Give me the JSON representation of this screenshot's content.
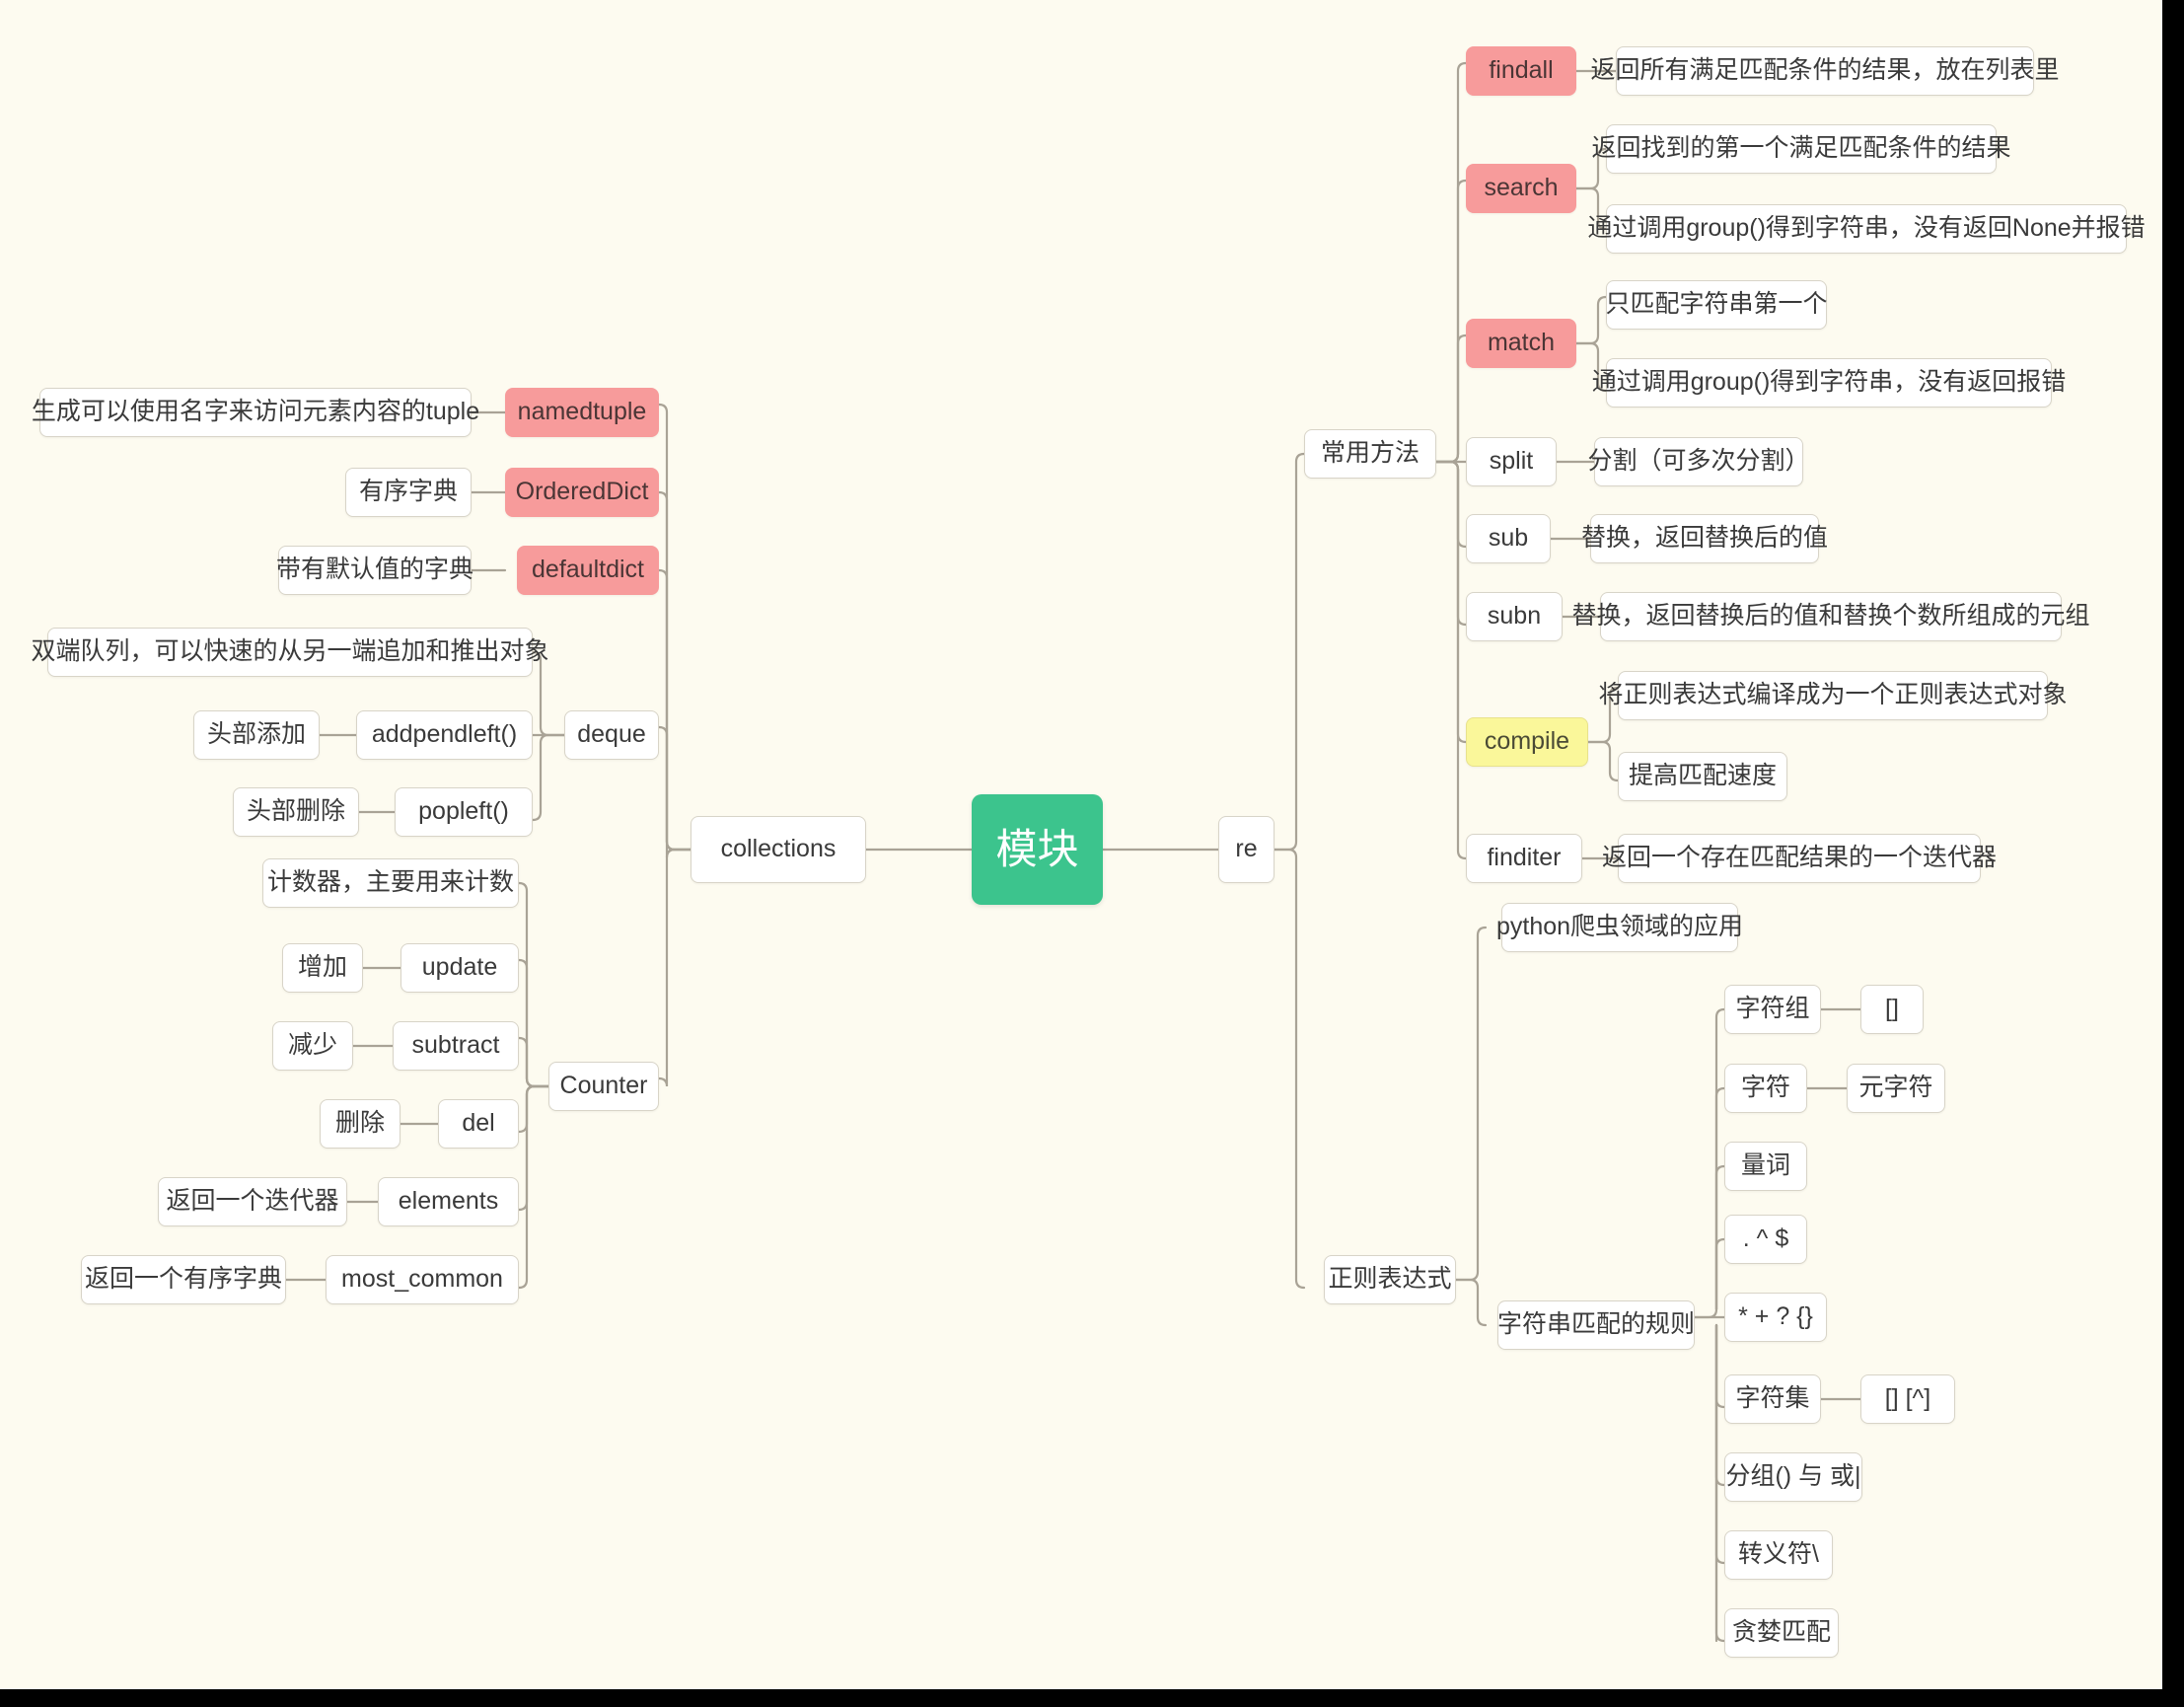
{
  "canvas": {
    "background": "#fdfbf0",
    "frame_color": "#000000",
    "edge_color": "#a9a396"
  },
  "root": {
    "label": "模块",
    "color": "#3cc48d",
    "text_color": "#ffffff"
  },
  "highlight_colors": {
    "pink": "#f79b9b",
    "yellow": "#faf79a",
    "plain": "#ffffff"
  },
  "branches": [
    {
      "id": "collections",
      "label": "collections",
      "side": "left",
      "children": [
        {
          "label": "namedtuple",
          "style": "pink",
          "children": [
            {
              "label": "生成可以使用名字来访问元素内容的tuple",
              "style": "plain"
            }
          ]
        },
        {
          "label": "OrderedDict",
          "style": "pink",
          "children": [
            {
              "label": "有序字典",
              "style": "plain"
            }
          ]
        },
        {
          "label": "defaultdict",
          "style": "pink",
          "children": [
            {
              "label": "带有默认值的字典",
              "style": "plain"
            }
          ]
        },
        {
          "label": "deque",
          "style": "plain",
          "children": [
            {
              "label": "双端队列，可以快速的从另一端追加和推出对象",
              "style": "plain"
            },
            {
              "label": "addpendleft()",
              "style": "plain",
              "children": [
                {
                  "label": "头部添加",
                  "style": "plain"
                }
              ]
            },
            {
              "label": "popleft()",
              "style": "plain",
              "children": [
                {
                  "label": "头部删除",
                  "style": "plain"
                }
              ]
            }
          ]
        },
        {
          "label": "Counter",
          "style": "plain",
          "children": [
            {
              "label": "计数器，主要用来计数",
              "style": "plain"
            },
            {
              "label": "update",
              "style": "plain",
              "children": [
                {
                  "label": "增加",
                  "style": "plain"
                }
              ]
            },
            {
              "label": "subtract",
              "style": "plain",
              "children": [
                {
                  "label": "减少",
                  "style": "plain"
                }
              ]
            },
            {
              "label": "del",
              "style": "plain",
              "children": [
                {
                  "label": "删除",
                  "style": "plain"
                }
              ]
            },
            {
              "label": "elements",
              "style": "plain",
              "children": [
                {
                  "label": "返回一个迭代器",
                  "style": "plain"
                }
              ]
            },
            {
              "label": "most_common",
              "style": "plain",
              "children": [
                {
                  "label": "返回一个有序字典",
                  "style": "plain"
                }
              ]
            }
          ]
        }
      ]
    },
    {
      "id": "re",
      "label": "re",
      "side": "right",
      "children": [
        {
          "label": "常用方法",
          "style": "plain",
          "children": [
            {
              "label": "findall",
              "style": "pink",
              "children": [
                {
                  "label": "返回所有满足匹配条件的结果，放在列表里",
                  "style": "plain"
                }
              ]
            },
            {
              "label": "search",
              "style": "pink",
              "children": [
                {
                  "label": "返回找到的第一个满足匹配条件的结果",
                  "style": "plain"
                },
                {
                  "label": "通过调用group()得到字符串，没有返回None并报错",
                  "style": "plain"
                }
              ]
            },
            {
              "label": "match",
              "style": "pink",
              "children": [
                {
                  "label": "只匹配字符串第一个",
                  "style": "plain"
                },
                {
                  "label": "通过调用group()得到字符串，没有返回报错",
                  "style": "plain"
                }
              ]
            },
            {
              "label": "split",
              "style": "plain",
              "children": [
                {
                  "label": "分割（可多次分割）",
                  "style": "plain"
                }
              ]
            },
            {
              "label": "sub",
              "style": "plain",
              "children": [
                {
                  "label": "替换，返回替换后的值",
                  "style": "plain"
                }
              ]
            },
            {
              "label": "subn",
              "style": "plain",
              "children": [
                {
                  "label": "替换，返回替换后的值和替换个数所组成的元组",
                  "style": "plain"
                }
              ]
            },
            {
              "label": "compile",
              "style": "yellow",
              "children": [
                {
                  "label": "将正则表达式编译成为一个正则表达式对象",
                  "style": "plain"
                },
                {
                  "label": "提高匹配速度",
                  "style": "plain"
                }
              ]
            },
            {
              "label": "finditer",
              "style": "plain",
              "children": [
                {
                  "label": "返回一个存在匹配结果的一个迭代器",
                  "style": "plain"
                }
              ]
            }
          ]
        },
        {
          "label": "正则表达式",
          "style": "plain",
          "children": [
            {
              "label": "python爬虫领域的应用",
              "style": "plain"
            },
            {
              "label": "字符串匹配的规则",
              "style": "plain",
              "children": [
                {
                  "label": "字符组",
                  "style": "plain",
                  "children": [
                    {
                      "label": "[]",
                      "style": "plain"
                    }
                  ]
                },
                {
                  "label": "字符",
                  "style": "plain",
                  "children": [
                    {
                      "label": "元字符",
                      "style": "plain"
                    }
                  ]
                },
                {
                  "label": "量词",
                  "style": "plain"
                },
                {
                  "label": ". ^ $",
                  "style": "plain"
                },
                {
                  "label": "* + ? {}",
                  "style": "plain"
                },
                {
                  "label": "字符集",
                  "style": "plain",
                  "children": [
                    {
                      "label": "[] [^]",
                      "style": "plain"
                    }
                  ]
                },
                {
                  "label": "分组() 与 或|",
                  "style": "plain"
                },
                {
                  "label": "转义符\\",
                  "style": "plain"
                },
                {
                  "label": "贪婪匹配",
                  "style": "plain"
                }
              ]
            }
          ]
        }
      ]
    }
  ],
  "nodes": {
    "root": {
      "label": "模块"
    },
    "collections": {
      "label": "collections"
    },
    "re": {
      "label": "re"
    },
    "namedtuple": {
      "label": "namedtuple"
    },
    "namedtuple_desc": {
      "label": "生成可以使用名字来访问元素内容的tuple"
    },
    "ordereddict": {
      "label": "OrderedDict"
    },
    "ordereddict_desc": {
      "label": "有序字典"
    },
    "defaultdict": {
      "label": "defaultdict"
    },
    "defaultdict_desc": {
      "label": "带有默认值的字典"
    },
    "deque": {
      "label": "deque"
    },
    "deque_desc": {
      "label": "双端队列，可以快速的从另一端追加和推出对象"
    },
    "addpendleft": {
      "label": "addpendleft()"
    },
    "addpendleft_desc": {
      "label": "头部添加"
    },
    "popleft": {
      "label": "popleft()"
    },
    "popleft_desc": {
      "label": "头部删除"
    },
    "counter": {
      "label": "Counter"
    },
    "counter_desc": {
      "label": "计数器，主要用来计数"
    },
    "update": {
      "label": "update"
    },
    "update_desc": {
      "label": "增加"
    },
    "subtract": {
      "label": "subtract"
    },
    "subtract_desc": {
      "label": "减少"
    },
    "del": {
      "label": "del"
    },
    "del_desc": {
      "label": "删除"
    },
    "elements": {
      "label": "elements"
    },
    "elements_desc": {
      "label": "返回一个迭代器"
    },
    "most_common": {
      "label": "most_common"
    },
    "most_common_desc": {
      "label": "返回一个有序字典"
    },
    "common_methods": {
      "label": "常用方法"
    },
    "findall": {
      "label": "findall"
    },
    "findall_desc": {
      "label": "返回所有满足匹配条件的结果，放在列表里"
    },
    "search": {
      "label": "search"
    },
    "search_desc1": {
      "label": "返回找到的第一个满足匹配条件的结果"
    },
    "search_desc2": {
      "label": "通过调用group()得到字符串，没有返回None并报错"
    },
    "match": {
      "label": "match"
    },
    "match_desc1": {
      "label": "只匹配字符串第一个"
    },
    "match_desc2": {
      "label": "通过调用group()得到字符串，没有返回报错"
    },
    "split": {
      "label": "split"
    },
    "split_desc": {
      "label": "分割（可多次分割）"
    },
    "sub": {
      "label": "sub"
    },
    "sub_desc": {
      "label": "替换，返回替换后的值"
    },
    "subn": {
      "label": "subn"
    },
    "subn_desc": {
      "label": "替换，返回替换后的值和替换个数所组成的元组"
    },
    "compile": {
      "label": "compile"
    },
    "compile_desc1": {
      "label": "将正则表达式编译成为一个正则表达式对象"
    },
    "compile_desc2": {
      "label": "提高匹配速度"
    },
    "finditer": {
      "label": "finditer"
    },
    "finditer_desc": {
      "label": "返回一个存在匹配结果的一个迭代器"
    },
    "regex": {
      "label": "正则表达式"
    },
    "regex_crawler": {
      "label": "python爬虫领域的应用"
    },
    "regex_rules": {
      "label": "字符串匹配的规则"
    },
    "char_group": {
      "label": "字符组"
    },
    "char_group_sym": {
      "label": "[]"
    },
    "char": {
      "label": "字符"
    },
    "char_meta": {
      "label": "元字符"
    },
    "quantifier": {
      "label": "量词"
    },
    "anchors": {
      "label": ". ^ $"
    },
    "repeats": {
      "label": "* + ? {}"
    },
    "char_set": {
      "label": "字符集"
    },
    "char_set_sym": {
      "label": "[] [^]"
    },
    "grouping": {
      "label": "分组() 与 或|"
    },
    "escape": {
      "label": "转义符\\"
    },
    "greedy": {
      "label": "贪婪匹配"
    }
  }
}
